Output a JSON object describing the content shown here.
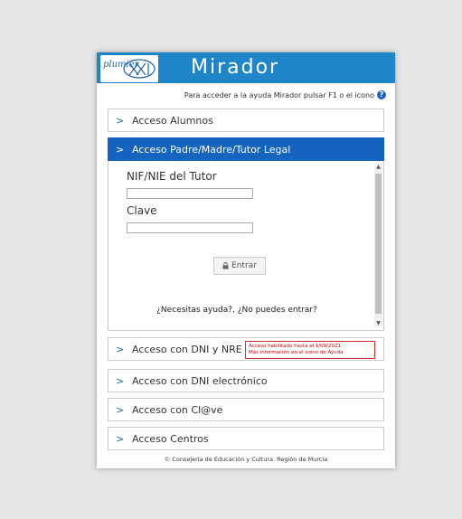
{
  "header": {
    "logo_text": "plumier",
    "title": "Mirador"
  },
  "help": {
    "text": "Para acceder a la ayuda Mirador pulsar F1 o el icono",
    "icon": "help-icon"
  },
  "sections": [
    {
      "label": "Acceso Alumnos"
    },
    {
      "label": "Acceso Padre/Madre/Tutor Legal"
    },
    {
      "label": "Acceso con DNI y NRE"
    },
    {
      "label": "Acceso con DNI electrónico"
    },
    {
      "label": "Acceso con Cl@ve"
    },
    {
      "label": "Acceso Centros"
    }
  ],
  "form": {
    "nif_label": "NIF/NIE del Tutor",
    "nif_value": "",
    "clave_label": "Clave",
    "clave_value": "",
    "submit_label": "Entrar",
    "help_link": "¿Necesitas ayuda?, ¿No puedes entrar?"
  },
  "notice": {
    "line1": "Acceso habilitado hasta el 1/09/2021.",
    "line2": "Más información en el icono de Ayuda"
  },
  "footer": {
    "text": "© Consejería de Educación y Cultura. Región de Murcia"
  },
  "colors": {
    "brand_blue": "#1e86c8",
    "active_section": "#1565c0",
    "notice_red": "#cc0000"
  }
}
